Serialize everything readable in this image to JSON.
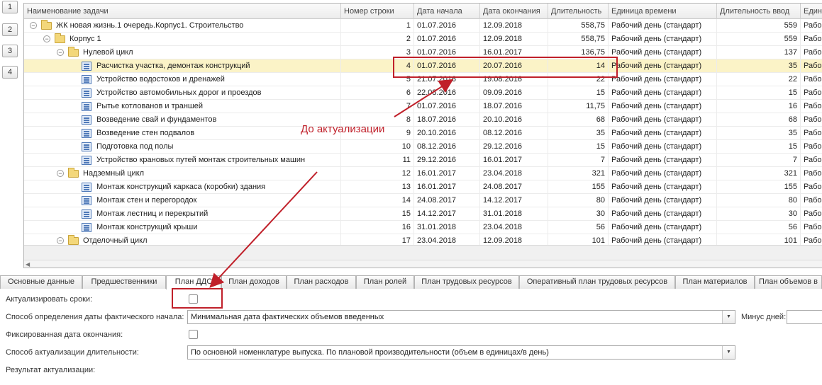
{
  "level_buttons": [
    "1",
    "2",
    "3",
    "4"
  ],
  "grid": {
    "columns": [
      "Наименование задачи",
      "Номер строки",
      "Дата начала",
      "Дата окончания",
      "Длительность",
      "Единица времени",
      "Длительность ввод",
      "Един"
    ],
    "rows": [
      {
        "level": 0,
        "kind": "folder",
        "toggle": "−",
        "name": "ЖК новая жизнь.1 очередь.Корпус1. Строительство",
        "num": "1",
        "start": "01.07.2016",
        "end": "12.09.2018",
        "dur": "558,75",
        "unit": "Рабочий день (стандарт)",
        "dur_in": "559",
        "unit2": "Рабо"
      },
      {
        "level": 1,
        "kind": "folder",
        "toggle": "−",
        "name": "Корпус 1",
        "num": "2",
        "start": "01.07.2016",
        "end": "12.09.2018",
        "dur": "558,75",
        "unit": "Рабочий день (стандарт)",
        "dur_in": "559",
        "unit2": "Рабо"
      },
      {
        "level": 2,
        "kind": "folder",
        "toggle": "−",
        "name": "Нулевой цикл",
        "num": "3",
        "start": "01.07.2016",
        "end": "16.01.2017",
        "dur": "136,75",
        "unit": "Рабочий день (стандарт)",
        "dur_in": "137",
        "unit2": "Рабо"
      },
      {
        "level": 3,
        "kind": "task",
        "toggle": "",
        "name": "Расчистка участка, демонтаж конструкций",
        "num": "4",
        "start": "01.07.2016",
        "end": "20.07.2016",
        "dur": "14",
        "unit": "Рабочий день (стандарт)",
        "dur_in": "35",
        "unit2": "Рабо",
        "selected": true
      },
      {
        "level": 3,
        "kind": "task",
        "toggle": "",
        "name": "Устройство водостоков и дренажей",
        "num": "5",
        "start": "21.07.2016",
        "end": "19.08.2016",
        "dur": "22",
        "unit": "Рабочий день (стандарт)",
        "dur_in": "22",
        "unit2": "Рабо"
      },
      {
        "level": 3,
        "kind": "task",
        "toggle": "",
        "name": "Устройство автомобильных дорог и проездов",
        "num": "6",
        "start": "22.08.2016",
        "end": "09.09.2016",
        "dur": "15",
        "unit": "Рабочий день (стандарт)",
        "dur_in": "15",
        "unit2": "Рабо"
      },
      {
        "level": 3,
        "kind": "task",
        "toggle": "",
        "name": "Рытье котлованов и траншей",
        "num": "7",
        "start": "01.07.2016",
        "end": "18.07.2016",
        "dur": "11,75",
        "unit": "Рабочий день (стандарт)",
        "dur_in": "16",
        "unit2": "Рабо"
      },
      {
        "level": 3,
        "kind": "task",
        "toggle": "",
        "name": "Возведение свай и фундаментов",
        "num": "8",
        "start": "18.07.2016",
        "end": "20.10.2016",
        "dur": "68",
        "unit": "Рабочий день (стандарт)",
        "dur_in": "68",
        "unit2": "Рабо"
      },
      {
        "level": 3,
        "kind": "task",
        "toggle": "",
        "name": "Возведение стен подвалов",
        "num": "9",
        "start": "20.10.2016",
        "end": "08.12.2016",
        "dur": "35",
        "unit": "Рабочий день (стандарт)",
        "dur_in": "35",
        "unit2": "Рабо"
      },
      {
        "level": 3,
        "kind": "task",
        "toggle": "",
        "name": "Подготовка под полы",
        "num": "10",
        "start": "08.12.2016",
        "end": "29.12.2016",
        "dur": "15",
        "unit": "Рабочий день (стандарт)",
        "dur_in": "15",
        "unit2": "Рабо"
      },
      {
        "level": 3,
        "kind": "task",
        "toggle": "",
        "name": "Устройство крановых путей монтаж строительных машин",
        "num": "11",
        "start": "29.12.2016",
        "end": "16.01.2017",
        "dur": "7",
        "unit": "Рабочий день (стандарт)",
        "dur_in": "7",
        "unit2": "Рабо"
      },
      {
        "level": 2,
        "kind": "folder",
        "toggle": "−",
        "name": "Надземный цикл",
        "num": "12",
        "start": "16.01.2017",
        "end": "23.04.2018",
        "dur": "321",
        "unit": "Рабочий день (стандарт)",
        "dur_in": "321",
        "unit2": "Рабо"
      },
      {
        "level": 3,
        "kind": "task",
        "toggle": "",
        "name": "Монтаж конструкций каркаса (коробки) здания",
        "num": "13",
        "start": "16.01.2017",
        "end": "24.08.2017",
        "dur": "155",
        "unit": "Рабочий день (стандарт)",
        "dur_in": "155",
        "unit2": "Рабо"
      },
      {
        "level": 3,
        "kind": "task",
        "toggle": "",
        "name": "Монтаж стен и перегородок",
        "num": "14",
        "start": "24.08.2017",
        "end": "14.12.2017",
        "dur": "80",
        "unit": "Рабочий день (стандарт)",
        "dur_in": "80",
        "unit2": "Рабо"
      },
      {
        "level": 3,
        "kind": "task",
        "toggle": "",
        "name": "Монтаж лестниц и перекрытий",
        "num": "15",
        "start": "14.12.2017",
        "end": "31.01.2018",
        "dur": "30",
        "unit": "Рабочий день (стандарт)",
        "dur_in": "30",
        "unit2": "Рабо"
      },
      {
        "level": 3,
        "kind": "task",
        "toggle": "",
        "name": "Монтаж конструкций крыши",
        "num": "16",
        "start": "31.01.2018",
        "end": "23.04.2018",
        "dur": "56",
        "unit": "Рабочий день (стандарт)",
        "dur_in": "56",
        "unit2": "Рабо"
      },
      {
        "level": 2,
        "kind": "folder",
        "toggle": "−",
        "name": "Отделочный цикл",
        "num": "17",
        "start": "23.04.2018",
        "end": "12.09.2018",
        "dur": "101",
        "unit": "Рабочий день (стандарт)",
        "dur_in": "101",
        "unit2": "Рабо"
      }
    ]
  },
  "annotation": {
    "text": "До актуализации",
    "color": "#c0202a"
  },
  "tabs": [
    "Основные данные",
    "Предшественники",
    "План ДДС",
    "План доходов",
    "План расходов",
    "План ролей",
    "План трудовых ресурсов",
    "Оперативный план трудовых ресурсов",
    "План материалов",
    "План объемов в"
  ],
  "form": {
    "actualize_label": "Актуализировать сроки:",
    "actualize_checked": false,
    "date_method_label": "Способ определения даты фактического начала:",
    "date_method_value": "Минимальная дата фактических объемов введенных",
    "minus_days_label": "Минус дней:",
    "minus_days_value": "",
    "fixed_end_label": "Фиксированная дата окончания:",
    "fixed_end_checked": false,
    "duration_method_label": "Способ актуализации длительности:",
    "duration_method_value": "По основной номенклатуре выпуска. По плановой производительности (объем в единицах/в день)",
    "result_label": "Результат актуализации:"
  },
  "colors": {
    "selected_row": "#fbf3c7",
    "annotation": "#c0202a"
  }
}
